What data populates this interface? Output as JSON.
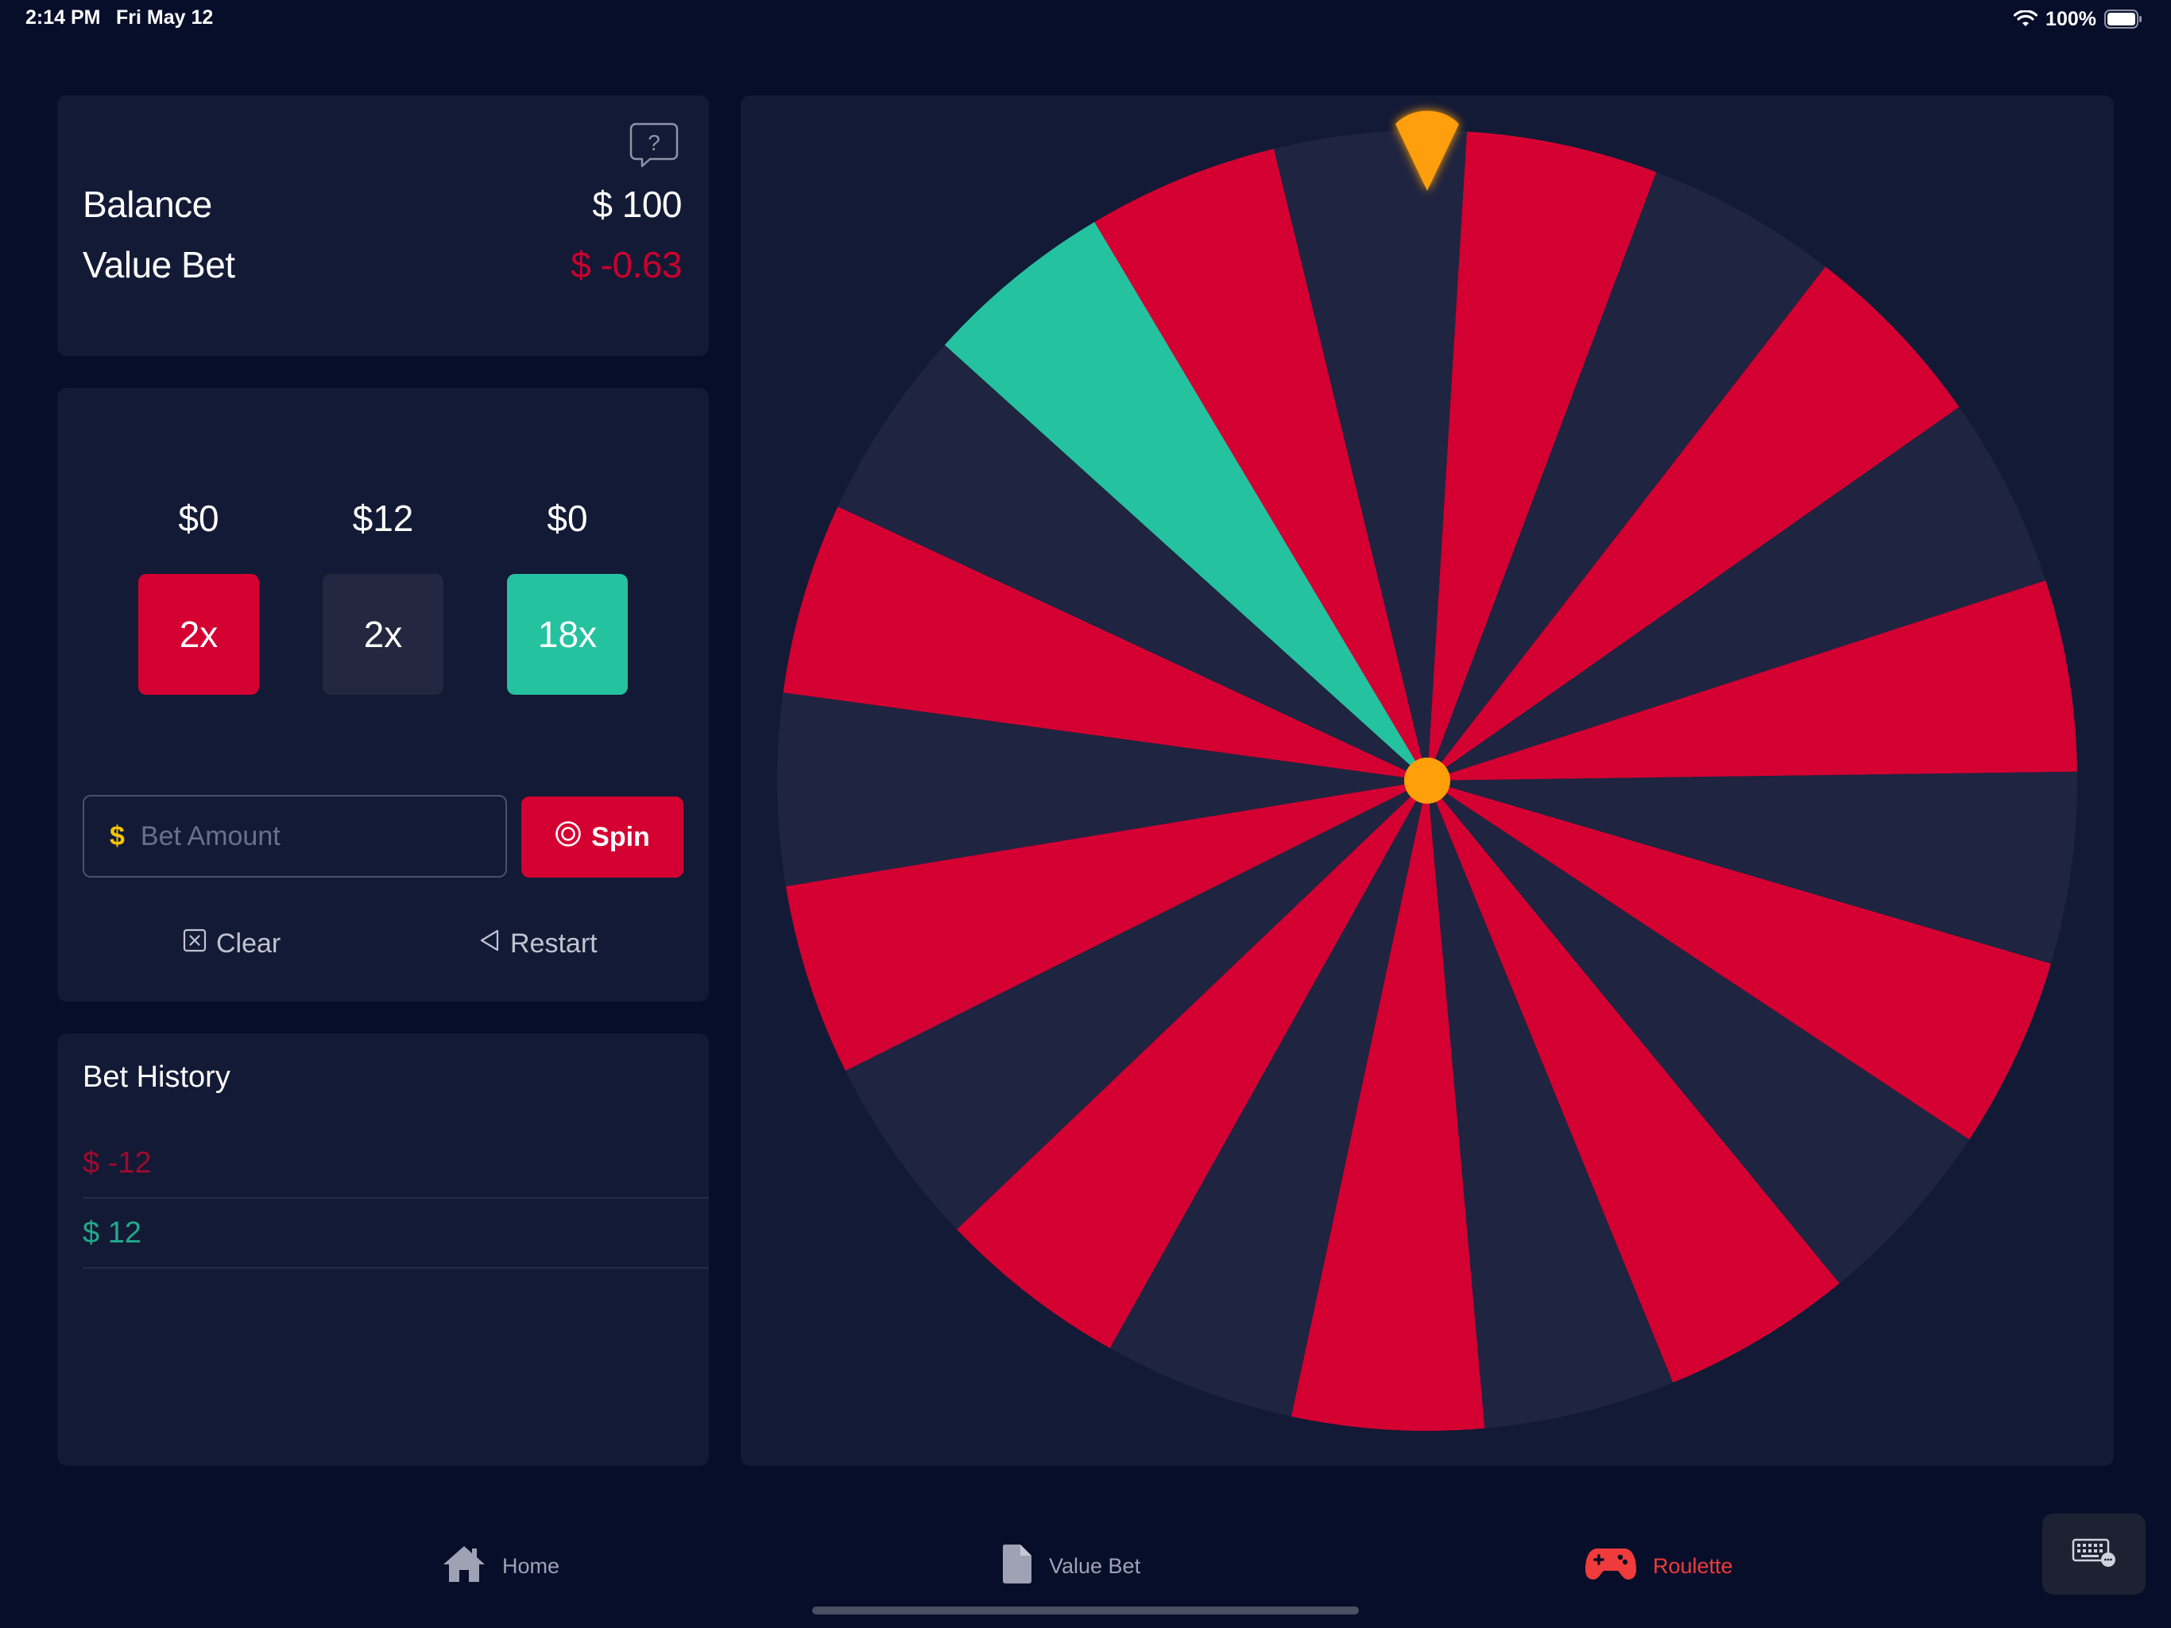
{
  "status_bar": {
    "time": "2:14 PM",
    "date": "Fri May 12",
    "battery": "100%"
  },
  "balance_panel": {
    "balance_label": "Balance",
    "balance_value": "$ 100",
    "value_bet_label": "Value Bet",
    "value_bet_value": "$ -0.63",
    "help_icon": "question-bubble-icon"
  },
  "bet_panel": {
    "chips": [
      {
        "amount": "$0",
        "multiplier": "2x",
        "color": "#d40032"
      },
      {
        "amount": "$12",
        "multiplier": "2x",
        "color": "#232840"
      },
      {
        "amount": "$0",
        "multiplier": "18x",
        "color": "#25c29f"
      }
    ],
    "bet_input": {
      "currency": "$",
      "placeholder": "Bet Amount"
    },
    "spin_label": "Spin",
    "clear_label": "Clear",
    "restart_label": "Restart"
  },
  "history": {
    "title": "Bet History",
    "entries": [
      {
        "text": "$ -12",
        "color": "#9e0a2e"
      },
      {
        "text": "$ 12",
        "color": "#22a989"
      }
    ]
  },
  "wheel": {
    "segment_colors": [
      "#d40032",
      "#1f2440",
      "#d40032",
      "#1f2440",
      "#d40032",
      "#1f2440",
      "#d40032",
      "#1f2440",
      "#d40032",
      "#1f2440",
      "#d40032",
      "#1f2440",
      "#d40032",
      "#1f2440",
      "#d40032",
      "#1f2440",
      "#d40032",
      "#1f2440",
      "#25c29f",
      "#d40032",
      "#1f2440"
    ],
    "pointer_color": "#ff9f0a",
    "hub_color": "#ff9f0a"
  },
  "tab_bar": {
    "tabs": [
      {
        "label": "Home",
        "icon": "house-icon",
        "active": false
      },
      {
        "label": "Value Bet",
        "icon": "document-icon",
        "active": false
      },
      {
        "label": "Roulette",
        "icon": "gamepad-icon",
        "active": true
      }
    ],
    "active_color": "#ef3b3b",
    "inactive_color": "#9ea2b4"
  },
  "keyboard_button": {
    "icon": "keyboard-icon"
  }
}
